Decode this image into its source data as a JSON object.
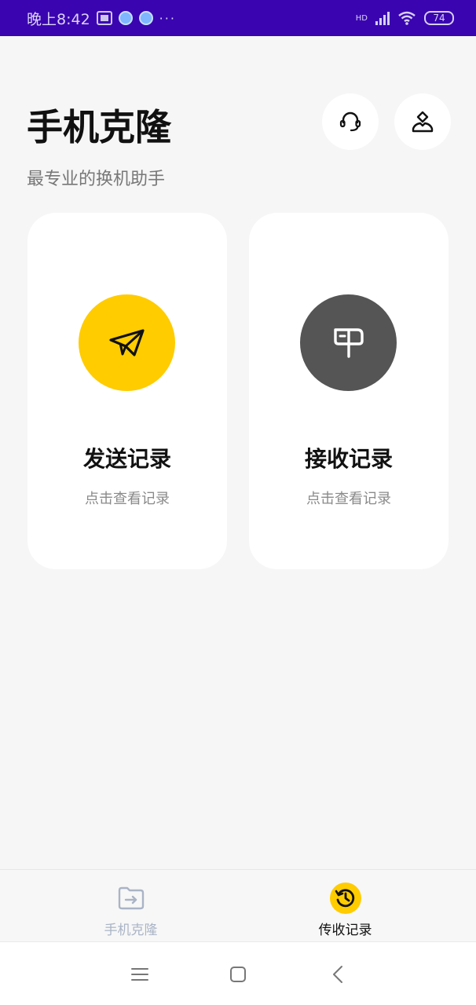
{
  "status_bar": {
    "time": "晚上8:42",
    "more": "···",
    "network": "HD",
    "battery": "74"
  },
  "header": {
    "title": "手机克隆",
    "subtitle": "最专业的换机助手"
  },
  "actions": {
    "support_icon": "headset-icon",
    "user_icon": "user-icon"
  },
  "cards": [
    {
      "title": "发送记录",
      "subtitle": "点击查看记录",
      "icon": "paper-plane-icon",
      "color": "#ffcc00"
    },
    {
      "title": "接收记录",
      "subtitle": "点击查看记录",
      "icon": "mailbox-icon",
      "color": "#555555"
    }
  ],
  "tabbar": {
    "tabs": [
      {
        "label": "手机克隆",
        "icon": "folder-transfer-icon",
        "active": false
      },
      {
        "label": "传收记录",
        "icon": "history-icon",
        "active": true
      }
    ]
  },
  "system_nav": {
    "buttons": [
      "menu-icon",
      "home-icon",
      "back-icon"
    ]
  }
}
